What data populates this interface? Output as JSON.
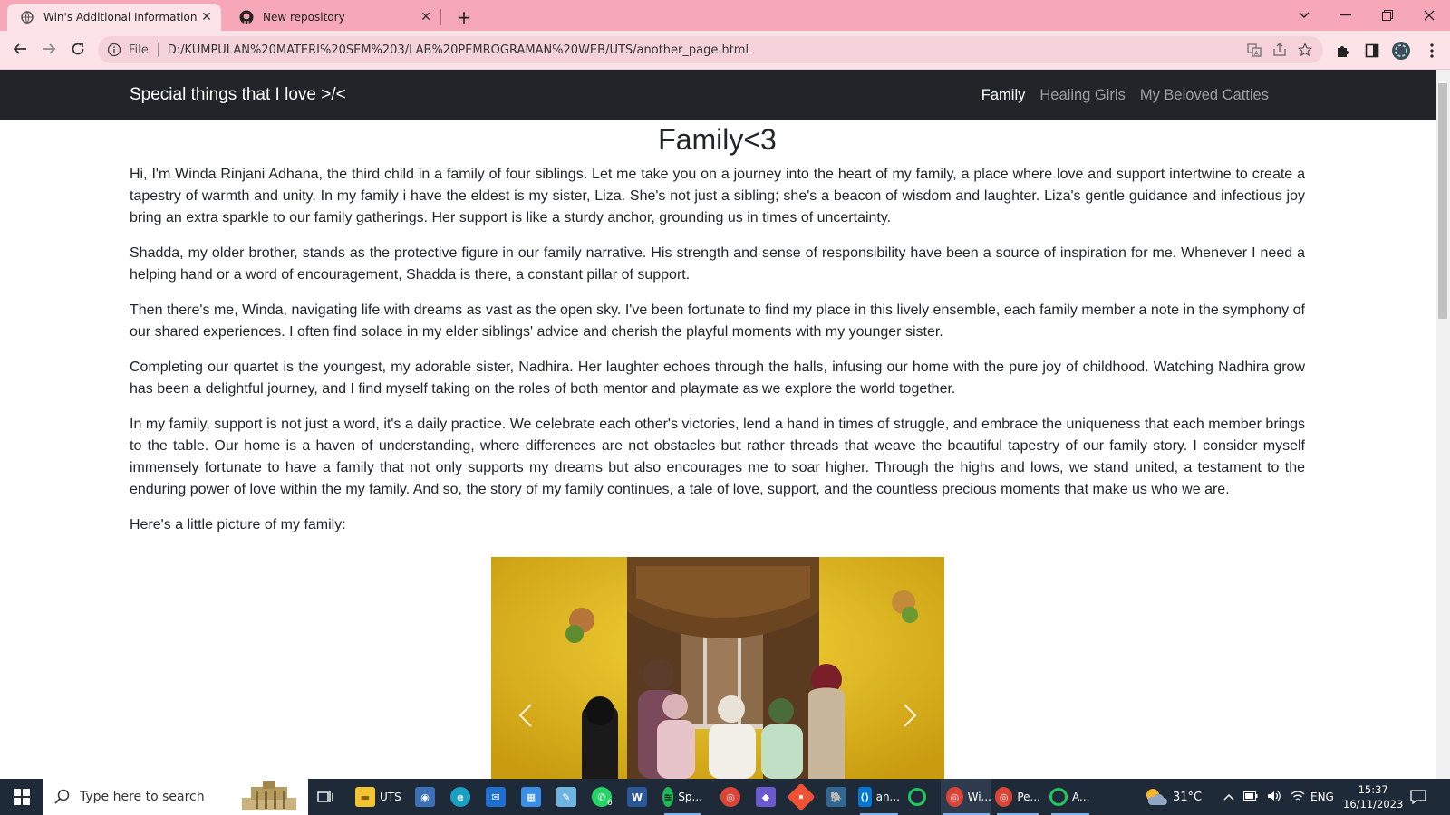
{
  "browser": {
    "tabs": [
      {
        "title": "Win's Additional Information",
        "active": true,
        "icon": "globe-icon"
      },
      {
        "title": "New repository",
        "active": false,
        "icon": "github-icon"
      }
    ],
    "new_tab": "+",
    "address": {
      "scheme": "File",
      "url": "D:/KUMPULAN%20MATERI%20SEM%203/LAB%20PEMROGRAMAN%20WEB/UTS/another_page.html"
    }
  },
  "site": {
    "brand": "Special things that I love >/<",
    "nav": [
      {
        "label": "Family",
        "active": true
      },
      {
        "label": "Healing Girls",
        "active": false
      },
      {
        "label": "My Beloved Catties",
        "active": false
      }
    ],
    "heading": "Family<3",
    "paragraphs": [
      "Hi, I'm Winda Rinjani Adhana, the third child in a family of four siblings. Let me take you on a journey into the heart of my family, a place where love and support intertwine to create a tapestry of warmth and unity. In my family i have the eldest is my sister, Liza. She's not just a sibling; she's a beacon of wisdom and laughter. Liza's gentle guidance and infectious joy bring an extra sparkle to our family gatherings. Her support is like a sturdy anchor, grounding us in times of uncertainty.",
      "Shadda, my older brother, stands as the protective figure in our family narrative. His strength and sense of responsibility have been a source of inspiration for me. Whenever I need a helping hand or a word of encouragement, Shadda is there, a constant pillar of support.",
      "Then there's me, Winda, navigating life with dreams as vast as the open sky. I've been fortunate to find my place in this lively ensemble, each family member a note in the symphony of our shared experiences. I often find solace in my elder siblings' advice and cherish the playful moments with my younger sister.",
      "Completing our quartet is the youngest, my adorable sister, Nadhira. Her laughter echoes through the halls, infusing our home with the pure joy of childhood. Watching Nadhira grow has been a delightful journey, and I find myself taking on the roles of both mentor and playmate as we explore the world together.",
      "In my family, support is not just a word, it's a daily practice. We celebrate each other's victories, lend a hand in times of struggle, and embrace the uniqueness that each member brings to the table. Our home is a haven of understanding, where differences are not obstacles but rather threads that weave the beautiful tapestry of our family story. I consider myself immensely fortunate to have a family that not only supports my dreams but also encourages me to soar higher. Through the highs and lows, we stand united, a testament to the enduring power of love within the my family. And so, the story of my family continues, a tale of love, support, and the countless precious moments that make us who we are.",
      "Here's a little picture of my family:"
    ],
    "carousel": {
      "image": "family-photo",
      "prev_icon": "chevron-left-icon",
      "next_icon": "chevron-right-icon"
    }
  },
  "taskbar": {
    "search_placeholder": "Type here to search",
    "apps": [
      {
        "label": "UTS"
      },
      {
        "label": "Sp..."
      },
      {
        "label": "an..."
      },
      {
        "label": "Wi..."
      },
      {
        "label": "Pe..."
      },
      {
        "label": "A..."
      }
    ],
    "whatsapp_badge": "6",
    "weather": "31°C",
    "language": "ENG",
    "time": "15:37",
    "date": "16/11/2023"
  }
}
